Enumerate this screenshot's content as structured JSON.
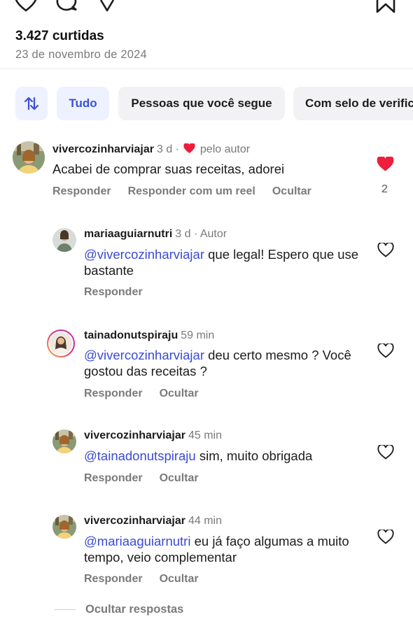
{
  "post": {
    "likes": "3.427 curtidas",
    "date": "23 de novembro de 2024"
  },
  "top_icons": [
    "heart-outline-icon",
    "comment-icon",
    "share-icon",
    "bookmark-icon"
  ],
  "filters": {
    "sort_icon": "sort-arrows-icon",
    "chips": [
      "Tudo",
      "Pessoas que você segue",
      "Com selo de verific"
    ],
    "active": "Tudo"
  },
  "colors": {
    "accent": "#3950d6",
    "mention": "#3a4bd4",
    "like_red": "#ed1d3b",
    "muted": "#7a7a7a"
  },
  "comments": [
    {
      "user": "vivercozinharviajar",
      "time": "3 d ·",
      "liked_by_author_label": "pelo autor",
      "text": "Acabei de comprar suas receitas, adorei",
      "actions": [
        "Responder",
        "Responder com um reel",
        "Ocultar"
      ],
      "liked": true,
      "like_count": "2"
    },
    {
      "user": "mariaaguiarnutri",
      "time": "3 d · Autor",
      "mention": "@vivercozinharviajar",
      "text": " que legal! Espero que use bastante",
      "actions": [
        "Responder"
      ]
    },
    {
      "user": "tainadonutspiraju",
      "time": "59 min",
      "mention": "@vivercozinharviajar",
      "text": " deu certo mesmo ? Você gostou das receitas ?",
      "actions": [
        "Responder",
        "Ocultar"
      ]
    },
    {
      "user": "vivercozinharviajar",
      "time": "45 min",
      "mention": "@tainadonutspiraju",
      "text": " sim, muito obrigada",
      "actions": [
        "Responder",
        "Ocultar"
      ]
    },
    {
      "user": "vivercozinharviajar",
      "time": "44 min",
      "mention": "@mariaaguiarnutri",
      "text": " eu já faço algumas a muito tempo, veio complementar",
      "actions": [
        "Responder",
        "Ocultar"
      ]
    }
  ],
  "hide_replies_label": "Ocultar respostas"
}
